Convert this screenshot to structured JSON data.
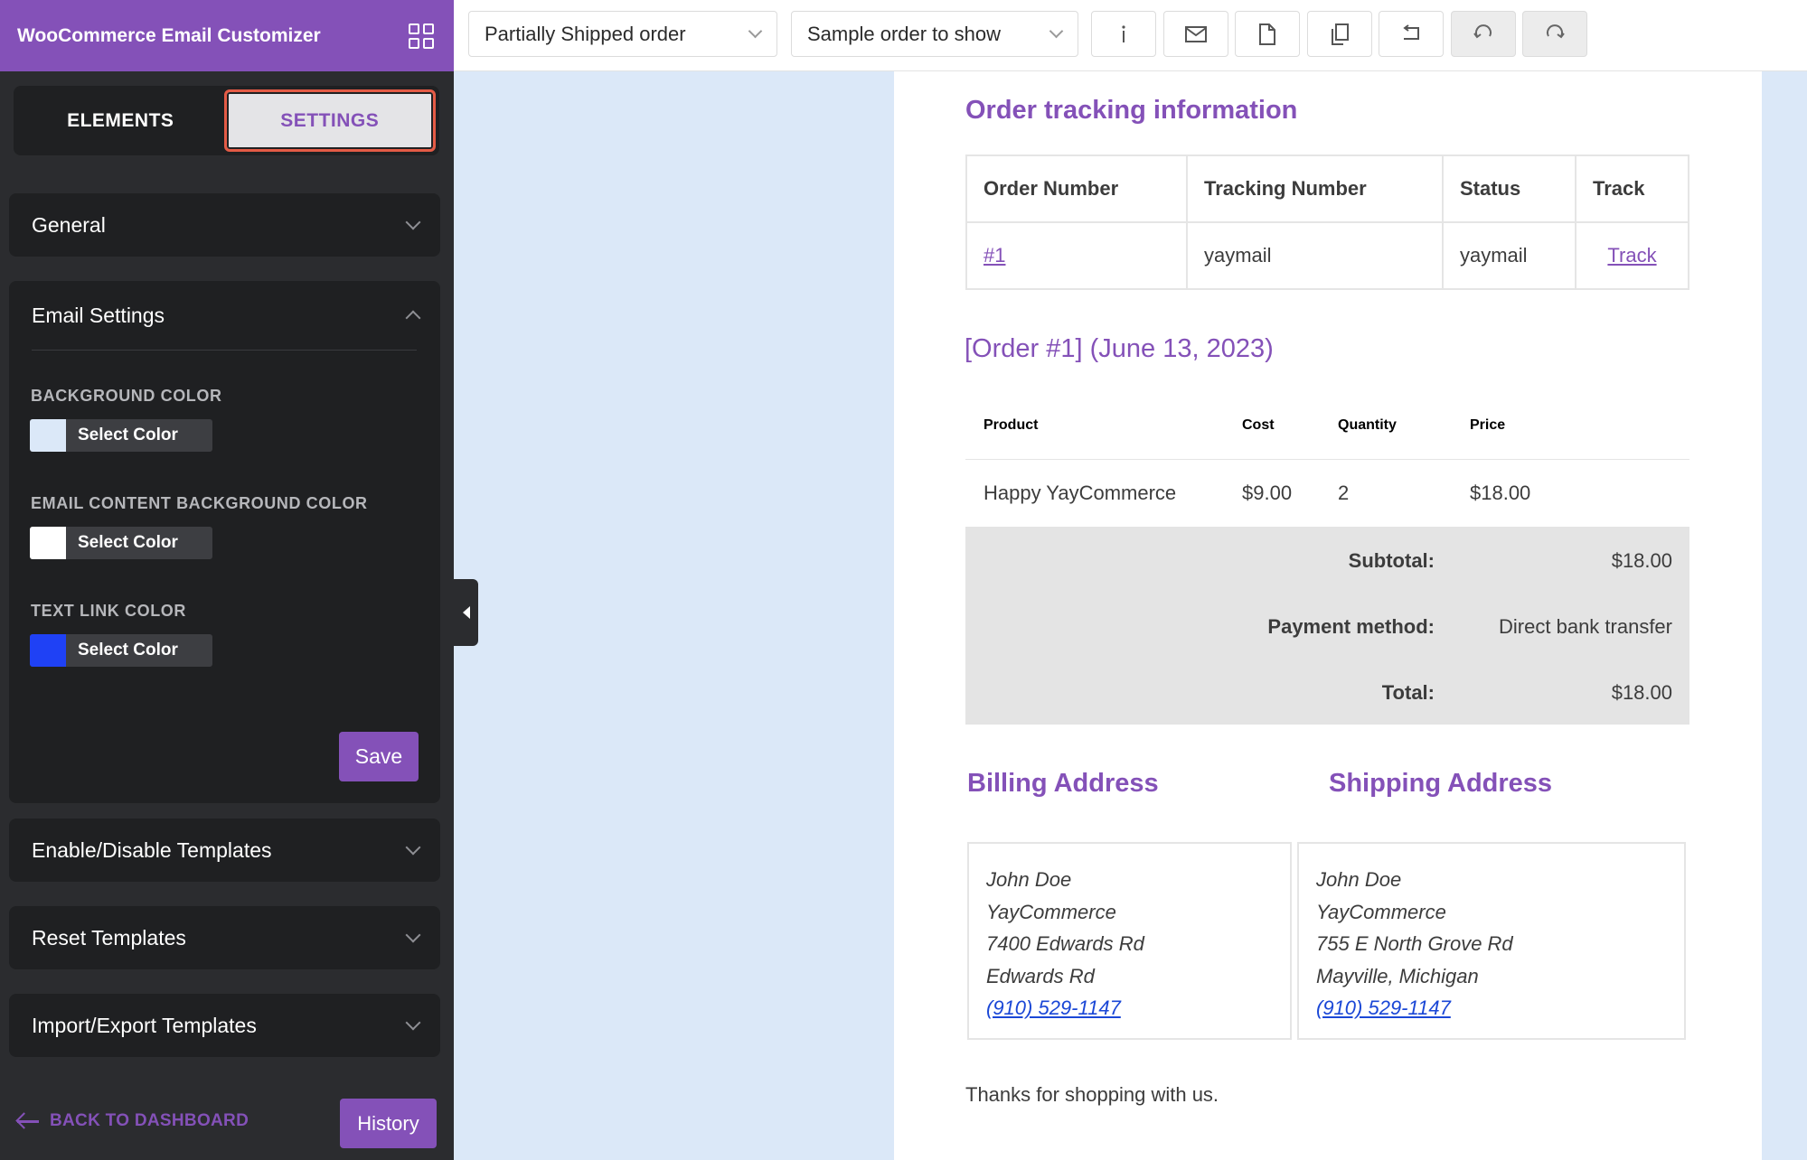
{
  "app": {
    "title": "WooCommerce Email Customizer",
    "menu_icon": "grid-icon"
  },
  "tabs": {
    "elements": "ELEMENTS",
    "settings": "SETTINGS"
  },
  "sidebar": {
    "general": "General",
    "email_settings": {
      "title": "Email Settings",
      "fields": [
        {
          "label": "BACKGROUND COLOR",
          "button": "Select Color",
          "color": "#dbe8f8"
        },
        {
          "label": "EMAIL CONTENT BACKGROUND COLOR",
          "button": "Select Color",
          "color": "#ffffff"
        },
        {
          "label": "TEXT LINK COLOR",
          "button": "Select Color",
          "color": "#1f41f5"
        }
      ],
      "save": "Save"
    },
    "enable_disable": "Enable/Disable Templates",
    "reset": "Reset Templates",
    "import_export": "Import/Export Templates",
    "back": "BACK TO DASHBOARD",
    "history": "History"
  },
  "toolbar": {
    "template_select": "Partially Shipped order",
    "order_select": "Sample order to show",
    "icons": [
      "info-icon",
      "mail-icon",
      "file-icon",
      "copy-icon",
      "undo-icon",
      "redo-icon",
      "redo-alt-icon"
    ]
  },
  "email": {
    "tracking_title": "Order tracking information",
    "tracking_headers": [
      "Order Number",
      "Tracking Number",
      "Status",
      "Track"
    ],
    "tracking_row": {
      "order": "#1",
      "tracking": "yaymail",
      "status": "yaymail",
      "track": "Track"
    },
    "order_title": "[Order #1] (June 13, 2023)",
    "product_headers": [
      "Product",
      "Cost",
      "Quantity",
      "Price"
    ],
    "product_row": {
      "product": "Happy YayCommerce",
      "cost": "$9.00",
      "qty": "2",
      "price": "$18.00"
    },
    "totals": [
      {
        "label": "Subtotal:",
        "value": "$18.00"
      },
      {
        "label": "Payment method:",
        "value": "Direct bank transfer"
      },
      {
        "label": "Total:",
        "value": "$18.00"
      }
    ],
    "billing": {
      "title": "Billing Address",
      "lines": [
        "John Doe",
        "YayCommerce",
        "7400 Edwards Rd",
        "Edwards Rd"
      ],
      "phone": "(910) 529-1147"
    },
    "shipping": {
      "title": "Shipping Address",
      "lines": [
        "John Doe",
        "YayCommerce",
        "755 E North Grove Rd",
        "Mayville, Michigan"
      ],
      "phone": "(910) 529-1147"
    },
    "thanks": "Thanks for shopping with us."
  },
  "colors": {
    "brand": "#8451b8",
    "sidebar_bg": "#2b2c2f",
    "canvas_bg": "#dbe8f8",
    "link": "#1a47d6"
  }
}
